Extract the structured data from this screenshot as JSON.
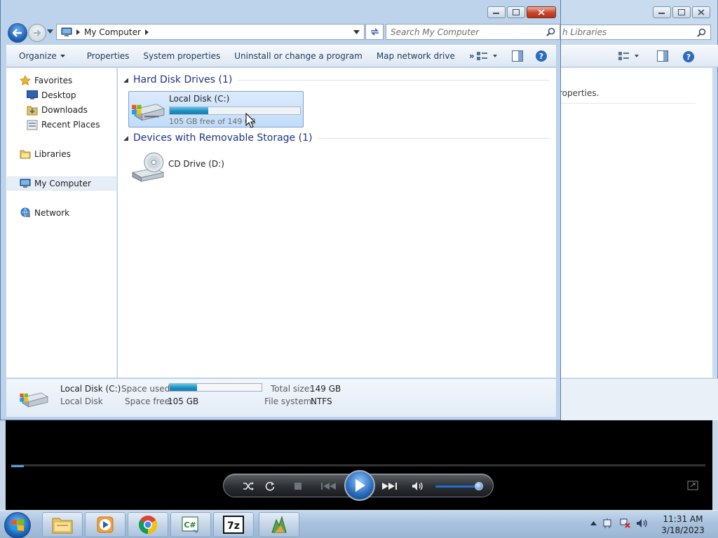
{
  "explorer": {
    "address": {
      "location": "My Computer"
    },
    "search": {
      "placeholder": "Search My Computer"
    },
    "command_bar": {
      "organize": "Organize",
      "properties": "Properties",
      "system_properties": "System properties",
      "uninstall": "Uninstall or change a program",
      "map_drive": "Map network drive",
      "more": "»"
    },
    "nav_pane": {
      "favorites": "Favorites",
      "desktop": "Desktop",
      "downloads": "Downloads",
      "recent_places": "Recent Places",
      "libraries": "Libraries",
      "my_computer": "My Computer",
      "network": "Network"
    },
    "groups": {
      "hard_disk": "Hard Disk Drives (1)",
      "removable": "Devices with Removable Storage (1)"
    },
    "local_disk": {
      "name": "Local Disk (C:)",
      "free_text": "105 GB free of 149 GB",
      "used_fraction": 0.295
    },
    "cd_drive": {
      "name": "CD Drive (D:)"
    },
    "details": {
      "name": "Local Disk (C:)",
      "type": "Local Disk",
      "space_used_label": "Space used:",
      "space_free_label": "Space free:",
      "space_free_value": "105 GB",
      "total_size_label": "Total size:",
      "total_size_value": "149 GB",
      "file_system_label": "File system:",
      "file_system_value": "NTFS",
      "used_fraction": 0.295
    }
  },
  "libraries_window": {
    "search_placeholder": "h Libraries",
    "content_text": "roperties."
  },
  "media_player": {
    "seek_fraction": 0.018,
    "volume_fraction": 0.9
  },
  "taskbar": {
    "time": "11:31 AM",
    "date": "3/18/2023",
    "apps": [
      "explorer-icon",
      "media-player-icon",
      "chrome-icon",
      "csharp-icon",
      "7zip-icon",
      "app-icon"
    ]
  }
}
